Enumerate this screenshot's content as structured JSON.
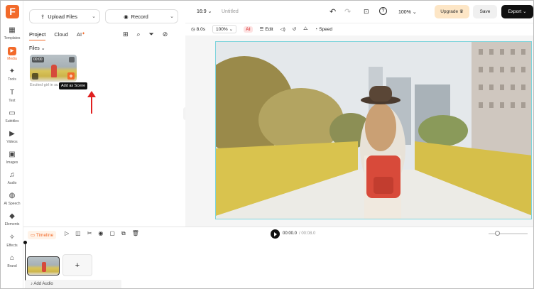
{
  "brand": {
    "logo_letter": "F",
    "accent": "#f26a2a"
  },
  "rail": [
    {
      "label": "Templates",
      "icon": "templates-icon",
      "glyph": "▦"
    },
    {
      "label": "Media",
      "icon": "media-icon",
      "glyph": "▸",
      "active": true
    },
    {
      "label": "Tools",
      "icon": "ai-tools-icon",
      "glyph": "✦"
    },
    {
      "label": "Text",
      "icon": "text-icon",
      "glyph": "T"
    },
    {
      "label": "Subtitles",
      "icon": "subtitles-icon",
      "glyph": "▭"
    },
    {
      "label": "Videos",
      "icon": "videos-icon",
      "glyph": "▶"
    },
    {
      "label": "Images",
      "icon": "images-icon",
      "glyph": "▣"
    },
    {
      "label": "Audio",
      "icon": "audio-icon",
      "glyph": "♫"
    },
    {
      "label": "AI Speech",
      "icon": "ai-speech-icon",
      "glyph": "◍"
    },
    {
      "label": "Elements",
      "icon": "elements-icon",
      "glyph": "◆"
    },
    {
      "label": "Effects",
      "icon": "effects-icon",
      "glyph": "✧"
    },
    {
      "label": "Brand",
      "icon": "brand-icon",
      "glyph": "⌂"
    }
  ],
  "panel": {
    "upload_label": "Upload Files",
    "record_label": "Record",
    "tabs": [
      "Project",
      "Cloud",
      "AI"
    ],
    "files_label": "Files",
    "file": {
      "duration": "00:00",
      "caption": "Excited girl in su"
    },
    "tooltip": "Add as Scene"
  },
  "topbar": {
    "ratio": "16:9",
    "title": "Untitled",
    "zoom": "100%",
    "upgrade_label": "Upgrade",
    "save_label": "Save",
    "export_label": "Export"
  },
  "toolbar": {
    "duration": "8.0s",
    "zoom": "100%",
    "ai_label": "AI",
    "edit_label": "Edit",
    "speed_label": "Speed"
  },
  "timeline": {
    "label": "Timeline",
    "current_time": "00:00.0",
    "total_time": "/ 00:08.0",
    "add_audio_label": "Add Audio",
    "add_scene_symbol": "+"
  }
}
